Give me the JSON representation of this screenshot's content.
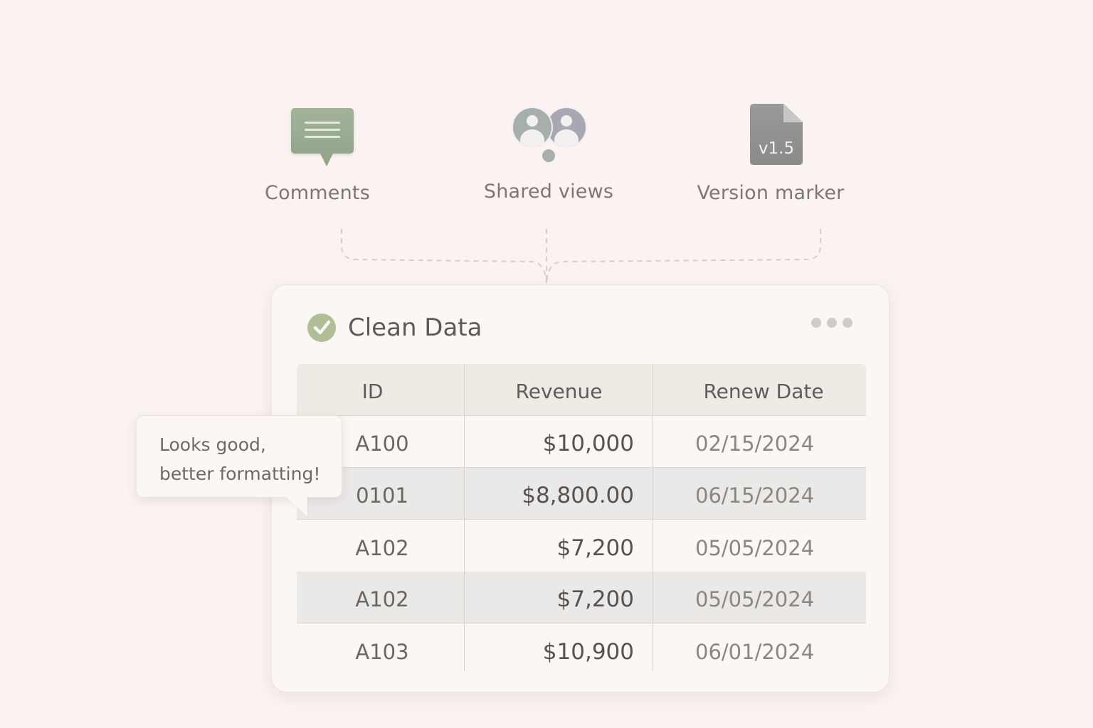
{
  "features": {
    "comments": {
      "label": "Comments",
      "icon": "comment-bubble-icon",
      "color": "#9aac90"
    },
    "shared": {
      "label": "Shared views",
      "icon": "users-icon",
      "color": "#a7adab"
    },
    "version": {
      "label": "Version marker",
      "icon": "file-version-icon",
      "version_text": "v1.5",
      "color": "#939392"
    }
  },
  "card": {
    "title": "Clean Data",
    "status_icon": "check-circle-icon",
    "status_color": "#afbe97",
    "menu_icon": "more-dots-icon",
    "columns": [
      "ID",
      "Revenue",
      "Renew Date"
    ],
    "rows": [
      {
        "id": "A100",
        "revenue": "$10,000",
        "renew_date": "02/15/2024"
      },
      {
        "id": "0101",
        "revenue": "$8,800.00",
        "renew_date": "06/15/2024"
      },
      {
        "id": "A102",
        "revenue": "$7,200",
        "renew_date": "05/05/2024"
      },
      {
        "id": "A102",
        "revenue": "$7,200",
        "renew_date": "05/05/2024"
      },
      {
        "id": "A103",
        "revenue": "$10,900",
        "renew_date": "06/01/2024"
      }
    ]
  },
  "tooltip": {
    "line1": "Looks good,",
    "line2": "better formatting!"
  }
}
